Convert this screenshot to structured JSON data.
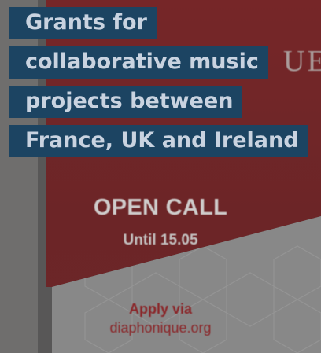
{
  "headline": {
    "lines": [
      "Grants for",
      "collaborative music",
      "projects between",
      "France, UK and Ireland"
    ]
  },
  "poster": {
    "logo_fragment": "UE",
    "title": "OPEN CALL",
    "date": "Until 15.05",
    "apply_label": "Apply via",
    "apply_site": "diaphonique.org"
  },
  "colors": {
    "headline_bg": "#1c4462",
    "headline_text": "#c9d3e0",
    "poster_red": "#8d2427",
    "backdrop": "#6f6e6d"
  }
}
